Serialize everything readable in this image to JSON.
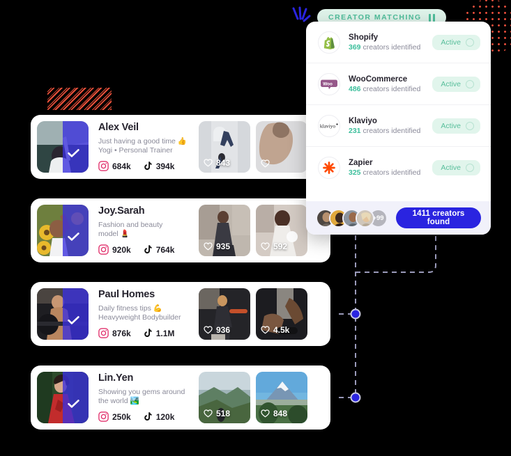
{
  "panel": {
    "badge_label": "CREATOR MATCHING",
    "badge_icon": "pause-icon",
    "brands": [
      {
        "logo": "shopify-logo",
        "name": "Shopify",
        "count": "369",
        "count_suffix": " creators identified",
        "status": "Active"
      },
      {
        "logo": "woocommerce-logo",
        "name": "WooCommerce",
        "count": "486",
        "count_suffix": " creators identified",
        "status": "Active"
      },
      {
        "logo": "klaviyo-logo",
        "name": "Klaviyo",
        "count": "231",
        "count_suffix": " creators identified",
        "status": "Active"
      },
      {
        "logo": "zapier-logo",
        "name": "Zapier",
        "count": "325",
        "count_suffix": " creators identified",
        "status": "Active"
      }
    ],
    "footer": {
      "avatar_overflow": "+99",
      "found_button_label": "1411 creators found"
    }
  },
  "creators": [
    {
      "name": "Alex Veil",
      "bio": "Just having a good time 👍",
      "bio2": "Yogi • Personal Trainer",
      "instagram": "684k",
      "tiktok": "394k",
      "posts": [
        {
          "likes": "843"
        },
        {
          "likes": ""
        }
      ]
    },
    {
      "name": "Joy.Sarah",
      "bio": "Fashion and beauty",
      "bio2": "model 💄",
      "instagram": "920k",
      "tiktok": "764k",
      "posts": [
        {
          "likes": "935"
        },
        {
          "likes": "592"
        }
      ]
    },
    {
      "name": "Paul Homes",
      "bio": "Daily fitness tips 💪",
      "bio2": "Heavyweight Bodybuilder",
      "instagram": "876k",
      "tiktok": "1.1M",
      "posts": [
        {
          "likes": "936"
        },
        {
          "likes": "4.5k"
        }
      ]
    },
    {
      "name": "Lin.Yen",
      "bio": "Showing you gems around",
      "bio2": "the world 🏞️",
      "instagram": "250k",
      "tiktok": "120k",
      "posts": [
        {
          "likes": "518"
        },
        {
          "likes": "848"
        }
      ]
    }
  ],
  "colors": {
    "background": "#000000",
    "accent_blue": "#2A24E0",
    "accent_green": "#4FBE9B",
    "accent_red": "#E8503A",
    "panel_footer": "#F1F1FA",
    "card_white": "#FFFFFF"
  }
}
